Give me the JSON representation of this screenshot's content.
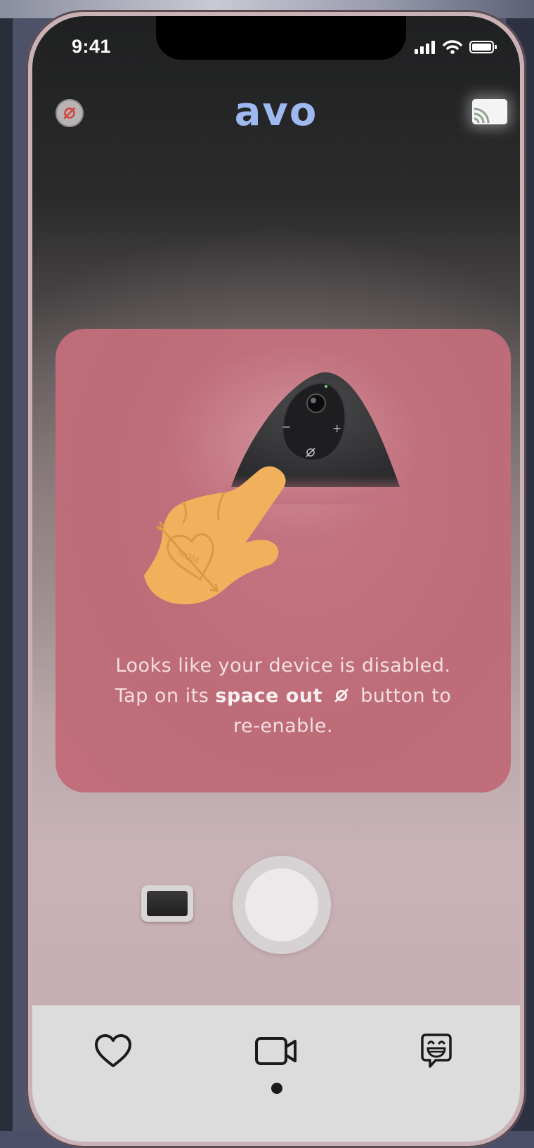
{
  "status_bar": {
    "time": "9:41"
  },
  "header": {
    "logo_text": "avo",
    "left_badge_icon": "space-out-icon",
    "right_button_icon": "cast-icon"
  },
  "disabled_card": {
    "message_line1": "Looks like your device is disabled.",
    "message_prefix": "Tap on its",
    "message_bold": "space out",
    "message_suffix": "button to",
    "message_line3": "re-enable.",
    "tattoo_text": "MOM",
    "device_minus": "−",
    "device_plus": "+"
  },
  "controls": {
    "thumbnail_icon": "preview-thumbnail",
    "shutter_icon": "shutter-button"
  },
  "tab_bar": {
    "tabs": [
      {
        "icon": "heart-icon",
        "active": false
      },
      {
        "icon": "video-camera-icon",
        "active": true
      },
      {
        "icon": "chat-emoji-icon",
        "active": false
      }
    ]
  },
  "colors": {
    "logo": "#9eb8f0",
    "card": "#bd6c78",
    "hand": "#f0b05c",
    "tab_bar": "#dcdcdc"
  }
}
